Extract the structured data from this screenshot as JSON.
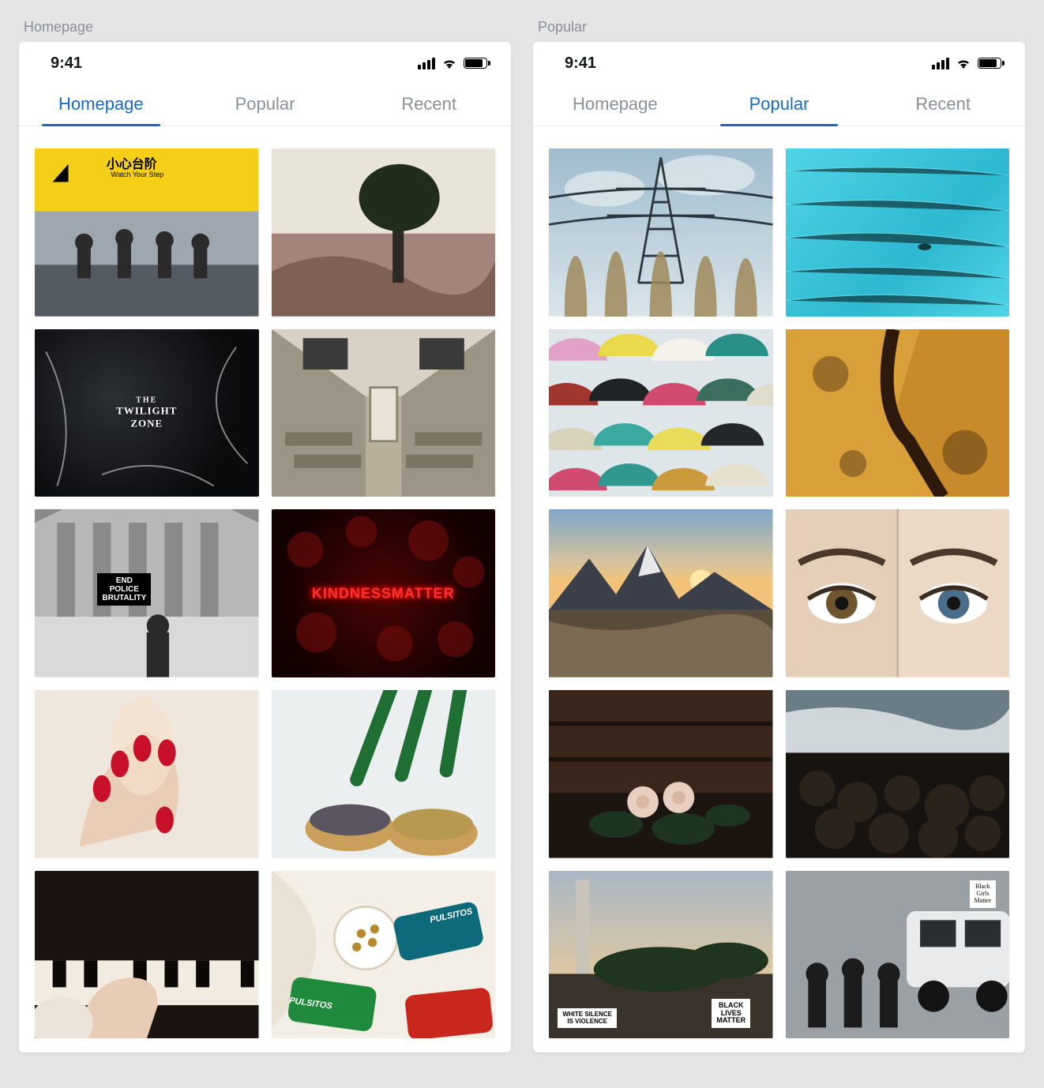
{
  "status": {
    "time": "9:41"
  },
  "tabs": [
    "Homepage",
    "Popular",
    "Recent"
  ],
  "screens": [
    {
      "title": "Homepage",
      "active_tab_index": 0
    },
    {
      "title": "Popular",
      "active_tab_index": 1
    }
  ],
  "grids": {
    "homepage": [
      {
        "name": "watch-your-step-cn",
        "cn": "小心台阶",
        "en": "Watch Your Step"
      },
      {
        "name": "canyon-tree"
      },
      {
        "name": "twilight-zone",
        "title_small": "THE",
        "title_big": "TWILIGHT\nZONE"
      },
      {
        "name": "empty-train"
      },
      {
        "name": "protest-end-brutality",
        "sign": "END\nPOLICE\nBRUTALITY"
      },
      {
        "name": "neon-kindness",
        "text": "KINDNESSMATTER"
      },
      {
        "name": "red-nails-glass"
      },
      {
        "name": "palm-bowls"
      },
      {
        "name": "piano-hands"
      },
      {
        "name": "pulsitos-snacks",
        "brand": "PULSITOS"
      }
    ],
    "popular": [
      {
        "name": "power-tower"
      },
      {
        "name": "turquoise-water"
      },
      {
        "name": "colorful-umbrellas"
      },
      {
        "name": "rusty-rock"
      },
      {
        "name": "mountain-sunset"
      },
      {
        "name": "two-eyes"
      },
      {
        "name": "roses-dark-wall"
      },
      {
        "name": "rocky-shore-wave"
      },
      {
        "name": "protest-blm",
        "sign1": "WHITE SILENCE\nIS VIOLENCE",
        "sign2": "BLACK\nLIVES\nMATTER"
      },
      {
        "name": "protest-suv",
        "sign": "Black\nGirls\nMatter"
      }
    ]
  },
  "colors": {
    "blue": "#1769c7",
    "muted": "#8a8f98"
  }
}
